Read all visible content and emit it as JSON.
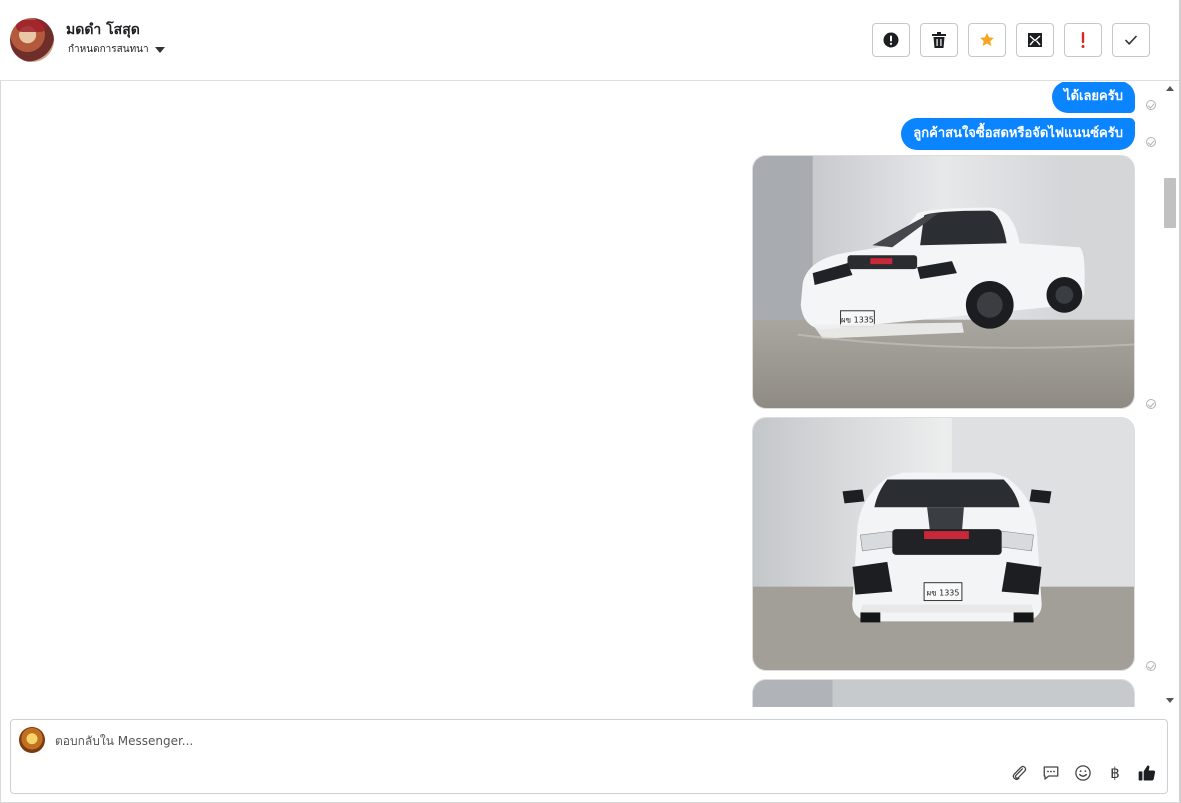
{
  "header": {
    "contact_name": "มดดำ โสสุด",
    "assign_label": "กำหนดการสนทนา",
    "toolbar": [
      {
        "name": "report-button",
        "icon": "exclamation-circle-icon"
      },
      {
        "name": "delete-button",
        "icon": "trash-icon"
      },
      {
        "name": "star-button",
        "icon": "star-icon",
        "color": "#f5a623"
      },
      {
        "name": "mark-unread-button",
        "icon": "envelope-icon"
      },
      {
        "name": "spam-button",
        "icon": "exclamation-icon",
        "color": "#e02424"
      },
      {
        "name": "done-button",
        "icon": "check-icon"
      }
    ]
  },
  "messages": [
    {
      "type": "text",
      "text": "ได้เลยครับ"
    },
    {
      "type": "text",
      "text": "ลูกค้าสนใจซื้อสดหรือจัดไฟแนนซ์ครับ"
    },
    {
      "type": "image",
      "description": "white-isuzu-pickup-side",
      "plate": "ผข 1335"
    },
    {
      "type": "image",
      "description": "white-isuzu-pickup-front",
      "plate": "ผข 1335"
    },
    {
      "type": "image",
      "description": "third-photo-partial"
    }
  ],
  "colors": {
    "bubble": "#0a84ff",
    "border": "#dddfe2"
  },
  "composer": {
    "placeholder": "ตอบกลับใน Messenger...",
    "tools": [
      "attachment-icon",
      "saved-reply-icon",
      "emoji-icon",
      "baht-icon",
      "thumbs-up-icon"
    ],
    "baht_symbol": "฿"
  }
}
